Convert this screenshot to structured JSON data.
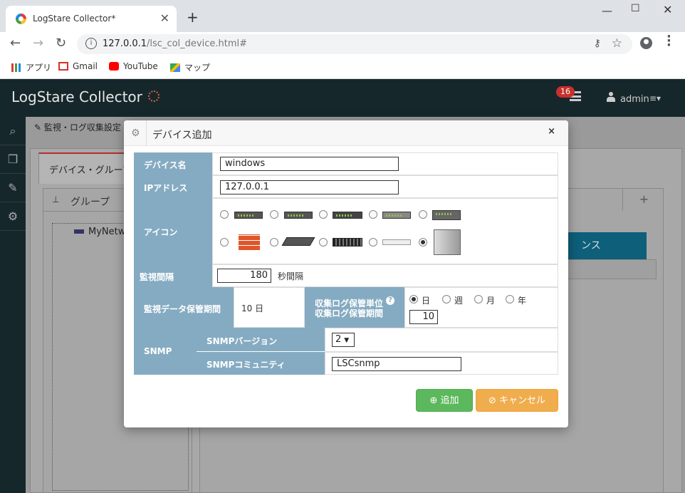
{
  "browser": {
    "tab_title": "LogStare Collector*",
    "tab_close": "✕",
    "new_tab": "+",
    "url_host": "127.0.0.1",
    "url_path": "/lsc_col_device.html#",
    "bookmarks": [
      "アプリ",
      "Gmail",
      "YouTube",
      "マップ"
    ]
  },
  "app": {
    "brand": "LogStare Collector",
    "notification_count": "16",
    "user": "admin",
    "breadcrumb": "監視・ログ収集設定",
    "tab_label": "デバイス・グループ",
    "group_title": "グループ",
    "tree_item": "MyNetw",
    "plus": "+",
    "blue_button_fragment": "ンス"
  },
  "modal": {
    "title": "デバイス追加",
    "close": "×",
    "device_name_label": "デバイス名",
    "device_name_value": "windows",
    "ip_label": "IPアドレス",
    "ip_value": "127.0.0.1",
    "icon_label": "アイコン",
    "icon_selected_index": 9,
    "interval_label": "監視間隔",
    "interval_value": "180",
    "interval_unit": "秒間隔",
    "retention_label": "監視データ保管期間",
    "retention_value": "10 日",
    "log_unit_label_1": "収集ログ保管単位",
    "log_unit_label_2": "収集ログ保管期間",
    "log_units": [
      "日",
      "週",
      "月",
      "年"
    ],
    "log_unit_selected": "日",
    "log_period_value": "10",
    "snmp_label": "SNMP",
    "snmp_version_label": "SNMPバージョン",
    "snmp_version_value": "2",
    "snmp_community_label": "SNMPコミュニティ",
    "snmp_community_value": "LSCsnmp",
    "add_button": "追加",
    "cancel_button": "キャンセル"
  },
  "colors": {
    "label_bg": "#85abc2",
    "add": "#5cb85c",
    "cancel": "#f0ad4e",
    "header": "#16272c"
  }
}
